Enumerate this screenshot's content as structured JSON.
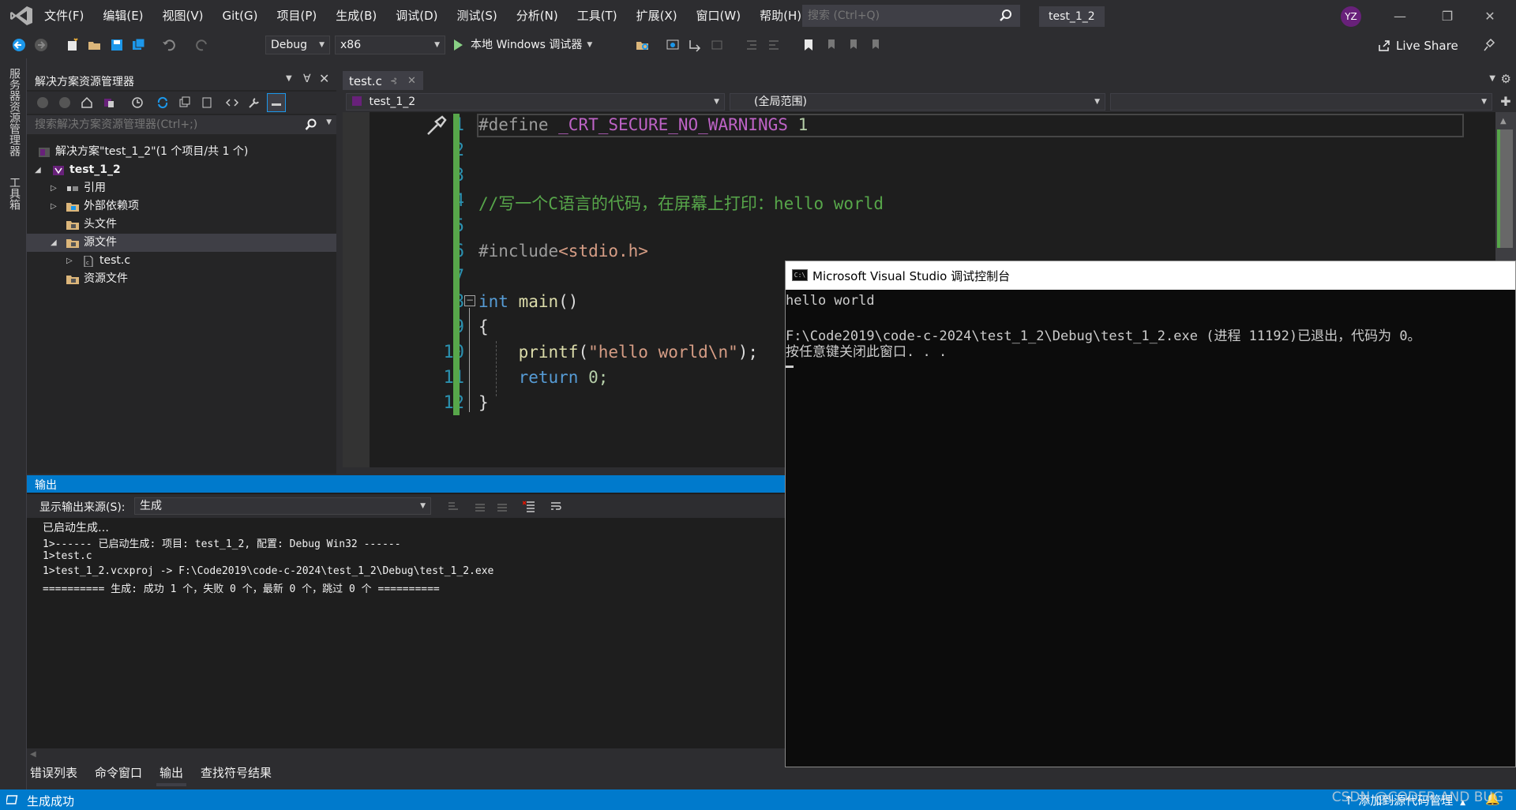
{
  "menu": [
    "文件(F)",
    "编辑(E)",
    "视图(V)",
    "Git(G)",
    "项目(P)",
    "生成(B)",
    "调试(D)",
    "测试(S)",
    "分析(N)",
    "工具(T)",
    "扩展(X)",
    "窗口(W)",
    "帮助(H)"
  ],
  "search": {
    "placeholder": "搜索 (Ctrl+Q)"
  },
  "project_badge": "test_1_2",
  "avatar_initials": "YZ",
  "toolbar": {
    "config": "Debug",
    "platform": "x86",
    "run_label": "本地 Windows 调试器",
    "live_share": "Live Share"
  },
  "left_strip": [
    "服务器资源管理器",
    "工具箱"
  ],
  "solution_explorer": {
    "title": "解决方案资源管理器",
    "search_placeholder": "搜索解决方案资源管理器(Ctrl+;)",
    "items": [
      {
        "label": "解决方案\"test_1_2\"(1 个项目/共 1 个)",
        "icon": "solution-icon",
        "bold": false
      },
      {
        "label": "test_1_2",
        "icon": "project-icon",
        "bold": true
      },
      {
        "label": "引用",
        "icon": "references-icon"
      },
      {
        "label": "外部依赖项",
        "icon": "folder-icon"
      },
      {
        "label": "头文件",
        "icon": "folder-icon"
      },
      {
        "label": "源文件",
        "icon": "folder-icon"
      },
      {
        "label": "test.c",
        "icon": "c-file-icon"
      },
      {
        "label": "资源文件",
        "icon": "folder-icon"
      }
    ]
  },
  "editor": {
    "tab": "test.c",
    "nav_file": "test_1_2",
    "nav_scope": "(全局范围)",
    "line_numbers": [
      "1",
      "2",
      "3",
      "4",
      "5",
      "6",
      "7",
      "8",
      "9",
      "10",
      "11",
      "12"
    ],
    "code": {
      "l1_define": "#define",
      "l1_macro": " _CRT_SECURE_NO_WARNINGS",
      "l1_num": " 1",
      "l4_comment": "//写一个C语言的代码，在屏幕上打印：hello world",
      "l6_include": "#include",
      "l6_header": "<stdio.h>",
      "l8_int": "int",
      "l8_main": " main",
      "l8_paren": "()",
      "l9": "{",
      "l10_printf": "    printf",
      "l10_open": "(",
      "l10_str": "\"hello world\\n\"",
      "l10_close": ");",
      "l11_return": "    return",
      "l11_rest": " 0;",
      "l12": "}"
    }
  },
  "output": {
    "title": "输出",
    "source_label": "显示输出来源(S):",
    "source_value": "生成",
    "lines": [
      "已启动生成…",
      "1>------ 已启动生成: 项目: test_1_2, 配置: Debug Win32 ------",
      "1>test.c",
      "1>test_1_2.vcxproj -> F:\\Code2019\\code-c-2024\\test_1_2\\Debug\\test_1_2.exe",
      "========== 生成: 成功 1 个，失败 0 个，最新 0 个，跳过 0 个 =========="
    ]
  },
  "bottom_tabs": [
    "错误列表",
    "命令窗口",
    "输出",
    "查找符号结果"
  ],
  "console": {
    "title": "Microsoft Visual Studio 调试控制台",
    "lines": [
      "hello world",
      "",
      "F:\\Code2019\\code-c-2024\\test_1_2\\Debug\\test_1_2.exe (进程 11192)已退出，代码为 0。",
      "按任意键关闭此窗口. . ."
    ]
  },
  "status": {
    "text": "生成成功",
    "right": "添加到源代码管理"
  },
  "watermark": "CSDN @CODER AND BUG"
}
